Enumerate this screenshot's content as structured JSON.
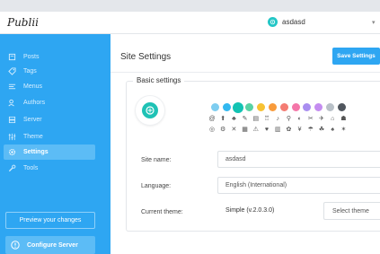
{
  "header": {
    "logo": "Publii",
    "user_name": "asdasd",
    "chevron": "▾"
  },
  "sidebar": {
    "items": [
      {
        "label": "Posts",
        "icon": "posts-icon"
      },
      {
        "label": "Tags",
        "icon": "tag-icon"
      },
      {
        "label": "Menus",
        "icon": "menu-icon"
      },
      {
        "label": "Authors",
        "icon": "authors-icon"
      },
      {
        "label": "Server",
        "icon": "server-icon"
      },
      {
        "label": "Theme",
        "icon": "theme-icon"
      },
      {
        "label": "Settings",
        "icon": "gear-icon"
      },
      {
        "label": "Tools",
        "icon": "wrench-icon"
      }
    ],
    "active": "Settings",
    "preview_button": "Preview your changes",
    "configure_button": "Configure Server"
  },
  "main": {
    "title": "Site Settings",
    "save_button": "Save Settings",
    "section_title": "Basic settings",
    "logo_colors": [
      "#7ecdf0",
      "#32b8f0",
      "#13c3b3",
      "#58d2a4",
      "#f7c233",
      "#f89b3b",
      "#f47c73",
      "#f476a8",
      "#a98ef0",
      "#c48df0",
      "#b9c1c8",
      "#50565e"
    ],
    "logo_icons_row1": [
      "@",
      "⬆",
      "♣",
      "✎",
      "▤",
      "♖",
      "♪",
      "⚲",
      "◐",
      "✂",
      "✈",
      "⌂",
      "☗"
    ],
    "logo_icons_row2": [
      "◎",
      "⚙",
      "✕",
      "▦",
      "⚠",
      "♥",
      "▥",
      "✿",
      "¥",
      "☂",
      "☘",
      "♠",
      "✶"
    ],
    "site_name_label": "Site name:",
    "site_name_value": "asdasd",
    "language_label": "Language:",
    "language_value": "English (International)",
    "theme_label": "Current theme:",
    "theme_value": "Simple (v.2.0.3.0)",
    "theme_select_placeholder": "Select theme"
  },
  "colors": {
    "sidebar": "#2ea6f2",
    "active_item": "#5cbcf6",
    "accent": "#2ea6f2",
    "preview_logo": "#1fc2b5"
  }
}
